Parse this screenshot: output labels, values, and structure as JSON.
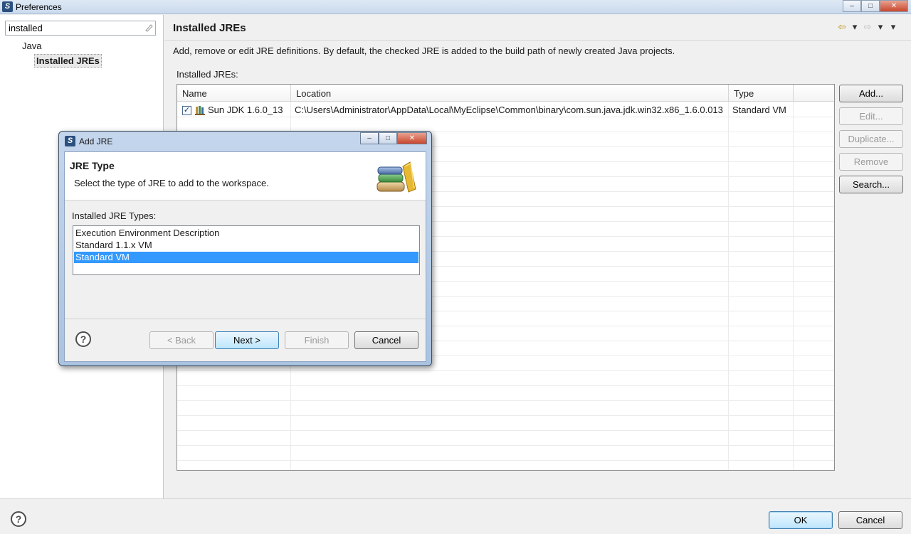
{
  "window": {
    "title": "Preferences",
    "minimize": "–",
    "maximize": "□",
    "close": "✕"
  },
  "sidebar": {
    "filter_value": "installed",
    "tree": {
      "java": "Java",
      "installed_jres": "Installed JREs"
    }
  },
  "page": {
    "heading": "Installed JREs",
    "description": "Add, remove or edit JRE definitions. By default, the checked JRE is added to the build path of newly created Java projects.",
    "installed_label": "Installed JREs:",
    "nav": {
      "back": "⇦",
      "back_menu": "▾",
      "forward": "⇨",
      "forward_menu": "▾",
      "view_menu": "▾"
    }
  },
  "table": {
    "headers": {
      "name": "Name",
      "location": "Location",
      "type": "Type"
    },
    "rows": [
      {
        "checked": "✓",
        "name": "Sun JDK 1.6.0_13",
        "location": "C:\\Users\\Administrator\\AppData\\Local\\MyEclipse\\Common\\binary\\com.sun.java.jdk.win32.x86_1.6.0.013",
        "type": "Standard VM"
      }
    ]
  },
  "side_buttons": {
    "add": "Add...",
    "edit": "Edit...",
    "duplicate": "Duplicate...",
    "remove": "Remove",
    "search": "Search..."
  },
  "footer": {
    "help": "?",
    "ok": "OK",
    "cancel": "Cancel"
  },
  "dialog": {
    "title": "Add JRE",
    "minimize": "–",
    "maximize": "□",
    "close": "✕",
    "heading": "JRE Type",
    "subheading": "Select the type of JRE to add to the workspace.",
    "types_label": "Installed JRE Types:",
    "types": [
      "Execution Environment Description",
      "Standard 1.1.x VM",
      "Standard VM"
    ],
    "selected_type": "Standard VM",
    "help": "?",
    "buttons": {
      "back": "< Back",
      "next": "Next >",
      "finish": "Finish",
      "cancel": "Cancel"
    }
  },
  "icons": {
    "app": "eclipse-icon",
    "jdk": "library-icon",
    "wizard": "books-icon"
  }
}
